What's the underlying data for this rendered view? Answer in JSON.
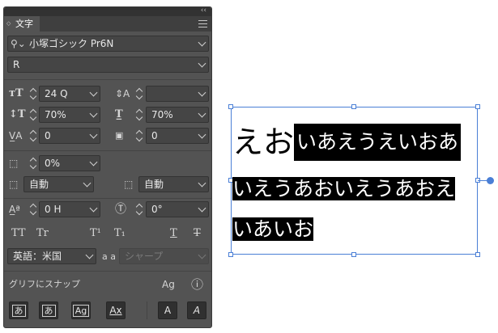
{
  "panel": {
    "tab_label": "文字",
    "collapse_glyph": "‹‹",
    "font_family": "小塚ゴシック Pr6N",
    "font_style": "R",
    "font_size": "24 Q",
    "leading": "",
    "vertical_scale": "70%",
    "horizontal_scale": "70%",
    "kerning": "0",
    "tracking": "0",
    "tsume": "0%",
    "aki_left": "自動",
    "aki_right": "自動",
    "baseline_shift": "0 H",
    "rotation": "0°",
    "language": "英語：米国",
    "aa_label": "a a",
    "antialias": "シャープ",
    "snap_label": "グリフにスナップ",
    "sym_caps": "TT",
    "sym_smallcaps": "Tr",
    "sym_super": "T¹",
    "sym_sub": "T₁",
    "sym_underline": "T",
    "sym_strike": "T",
    "snap_buttons": [
      "あ",
      "あ",
      "Ag",
      "Ax",
      "A",
      "A"
    ]
  },
  "canvas": {
    "line1_big": "えお",
    "line1_sel": "いあえうえいおあ",
    "line2": "いえうあおいえうあおえ",
    "line3": "いあいお"
  },
  "colors": {
    "panel_bg": "#535353",
    "field_bg": "#454545",
    "selection": "#4a7fd6"
  }
}
